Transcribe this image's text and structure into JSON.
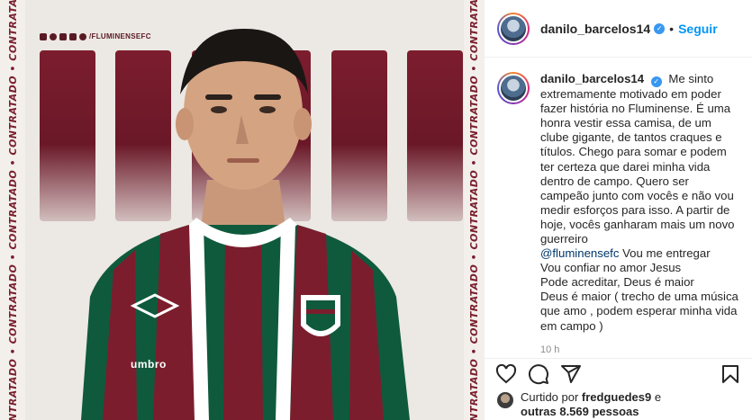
{
  "media": {
    "side_text": "CONTRATADO • CONTRATADO • CONTRATADO • CONTRATADO • CONTRATADO",
    "social_handle": "/FLUMINENSEFC",
    "kit_brand": "umbro",
    "colors": {
      "maroon": "#7c1d2e",
      "green": "#0f5a3c",
      "white": "#ffffff"
    }
  },
  "header": {
    "username": "danilo_barcelos14",
    "separator": "•",
    "follow_label": "Seguir"
  },
  "caption": {
    "username": "danilo_barcelos14",
    "text_before_mention": "Me sinto extremamente motivado em poder fazer história no Fluminense. É uma honra vestir essa camisa, de um clube gigante, de tantos craques e títulos. Chego para somar e podem ter certeza que darei minha vida dentro de campo. Quero ser campeão junto com vocês e não vou medir esforços para isso. A partir de hoje, vocês ganharam mais um novo guerreiro",
    "mention": "@fluminensefc",
    "text_after_mention": " Vou me entregar",
    "lines_extra": [
      "Vou confiar no amor Jesus",
      "Pode acreditar, Deus é maior",
      "Deus é maior ( trecho de uma música que amo , podem esperar minha vida em campo )"
    ],
    "timestamp": "10 h"
  },
  "actions": {
    "like_icon": "heart-icon",
    "comment_icon": "comment-icon",
    "share_icon": "share-icon",
    "save_icon": "bookmark-icon"
  },
  "likes": {
    "prefix": "Curtido por ",
    "user": "fredguedes9",
    "middle": " e",
    "others": "outras 8.569 pessoas"
  }
}
